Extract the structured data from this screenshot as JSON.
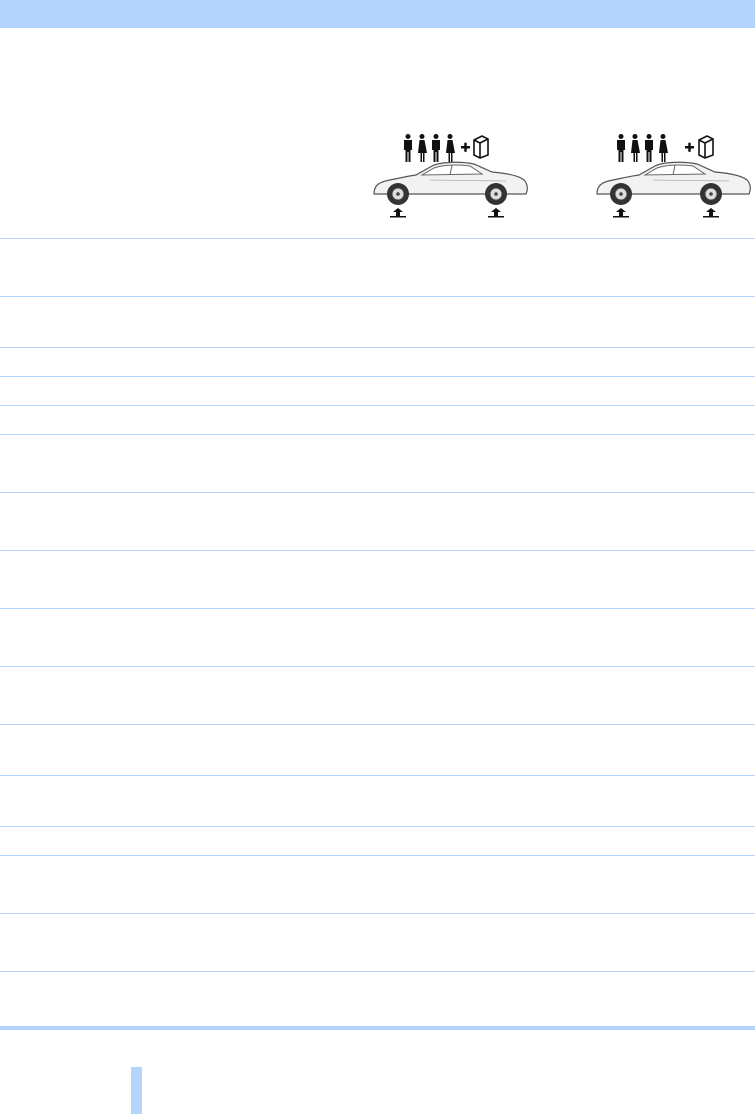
{
  "header": {
    "band_color": "#b3d4fc"
  },
  "figures": [
    {
      "name": "vehicle-load-figure-left",
      "icons": [
        "male-person-icon",
        "female-person-icon",
        "male-person-icon",
        "female-person-icon",
        "plus-icon",
        "luggage-icon",
        "coupe-car-icon",
        "front-axle-arrow-icon",
        "rear-axle-arrow-icon"
      ]
    },
    {
      "name": "vehicle-load-figure-right",
      "icons": [
        "male-person-icon",
        "female-person-icon",
        "male-person-icon",
        "female-person-icon",
        "plus-icon",
        "luggage-icon",
        "coupe-car-icon",
        "front-axle-arrow-icon",
        "rear-axle-arrow-icon"
      ]
    }
  ],
  "table": {
    "row_count": 14,
    "rule_color": "#b3d4fc"
  },
  "footer": {
    "tab_color": "#b3d4fc"
  }
}
